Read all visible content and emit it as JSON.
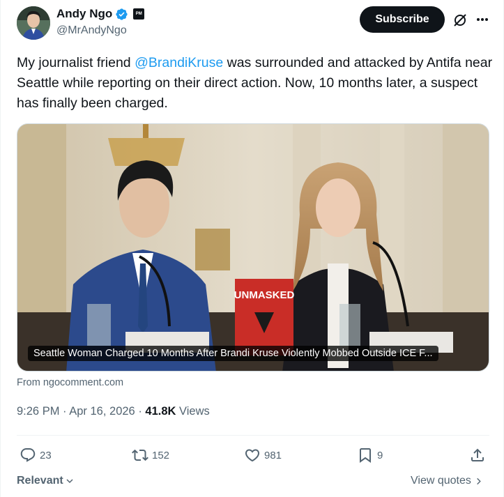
{
  "author": {
    "display_name": "Andy Ngo",
    "handle": "@MrAndyNgo",
    "affiliate_badge": "PM",
    "verified_color": "#1d9bf0"
  },
  "header": {
    "subscribe_label": "Subscribe",
    "grok_icon": "grok-icon",
    "more_icon": "more-icon"
  },
  "tweet": {
    "text_before": "My journalist friend ",
    "mention": "@BrandiKruse",
    "text_after": " was surrounded and attacked by Antifa near Seattle while reporting on their direct action. Now, 10 months later, a suspect has finally been charged."
  },
  "media": {
    "caption": "Seattle Woman Charged 10 Months After Brandi Kruse Violently Mobbed Outside ICE F...",
    "book_title": "UNMASKED",
    "from": "From ngocomment.com"
  },
  "meta": {
    "time": "9:26 PM",
    "separator": "·",
    "date": "Apr 16, 2026",
    "views_count": "41.8K",
    "views_label": "Views"
  },
  "actions": {
    "replies": "23",
    "reposts": "152",
    "likes": "981",
    "bookmarks": "9"
  },
  "footer": {
    "sort_label": "Relevant",
    "view_quotes_label": "View quotes"
  },
  "colors": {
    "accent": "#1d9bf0",
    "text_primary": "#0f1419",
    "text_secondary": "#536471"
  }
}
